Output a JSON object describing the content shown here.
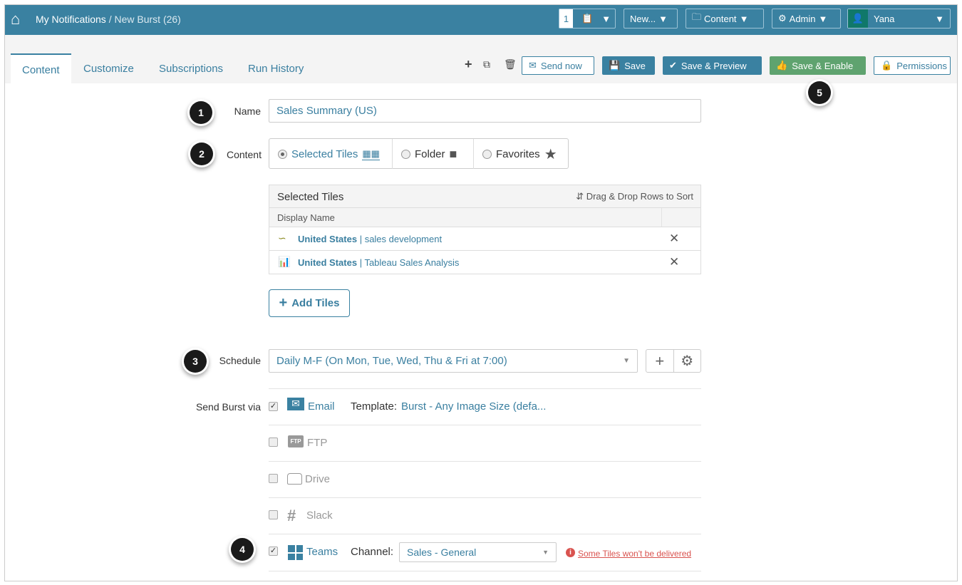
{
  "header": {
    "breadcrumb_root": "My Notifications",
    "breadcrumb_sep": " / ",
    "breadcrumb_current": "New Burst (26)",
    "clipboard_count": "1",
    "new_label": "New...",
    "content_label": "Content",
    "admin_label": "Admin",
    "user_name": "Yana"
  },
  "tabs": [
    {
      "label": "Content"
    },
    {
      "label": "Customize"
    },
    {
      "label": "Subscriptions"
    },
    {
      "label": "Run History"
    }
  ],
  "actions": {
    "send_now": "Send now",
    "save": "Save",
    "save_preview": "Save & Preview",
    "save_enable": "Save & Enable",
    "permissions": "Permissions"
  },
  "form": {
    "name_label": "Name",
    "name_value": "Sales Summary (US)",
    "content_label": "Content",
    "content_options": [
      {
        "label": "Selected Tiles",
        "selected": true
      },
      {
        "label": "Folder",
        "selected": false
      },
      {
        "label": "Favorites",
        "selected": false
      }
    ],
    "tiles_title": "Selected Tiles",
    "tiles_sort_hint": "Drag & Drop Rows to Sort",
    "tiles_col": "Display Name",
    "tiles": [
      {
        "bold": "United States",
        "sep": " | ",
        "name": "sales development"
      },
      {
        "bold": "United States",
        "sep": " | ",
        "name": "Tableau Sales Analysis"
      }
    ],
    "add_tiles": "Add Tiles",
    "schedule_label": "Schedule",
    "schedule_value": "Daily M-F (On Mon, Tue, Wed, Thu & Fri at 7:00)",
    "send_via_label": "Send Burst via",
    "channels": [
      {
        "label": "Email",
        "checked": true
      },
      {
        "label": "FTP",
        "checked": false
      },
      {
        "label": "Drive",
        "checked": false
      },
      {
        "label": "Slack",
        "checked": false
      },
      {
        "label": "Teams",
        "checked": true
      }
    ],
    "template_label": "Template:",
    "template_value": "Burst - Any Image Size (defa...",
    "channel_label": "Channel:",
    "channel_value": "Sales - General",
    "warning": "Some Tiles won't be delivered"
  },
  "callouts": [
    "1",
    "2",
    "3",
    "4",
    "5"
  ],
  "colors": {
    "brand": "#3a81a1",
    "green": "#5fa36f",
    "warning": "#d9534f"
  }
}
